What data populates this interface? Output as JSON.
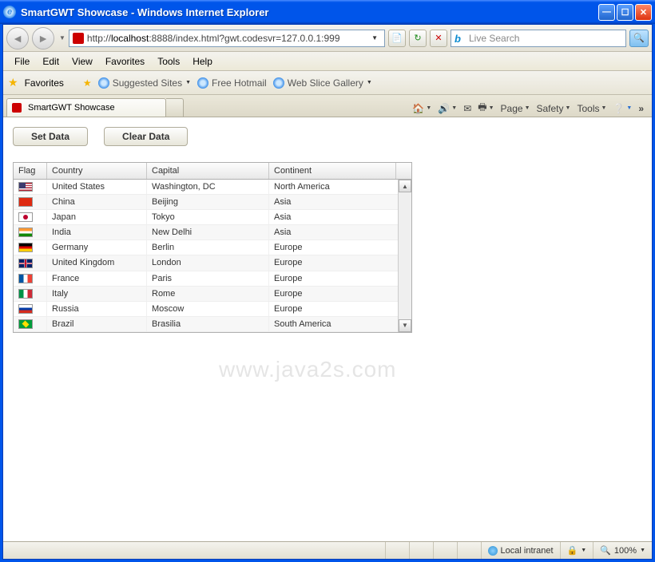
{
  "window": {
    "title": "SmartGWT Showcase - Windows Internet Explorer"
  },
  "nav": {
    "url_prefix": "http://",
    "url_host": "localhost",
    "url_rest": ":8888/index.html?gwt.codesvr=127.0.0.1:999",
    "refresh_glyph": "↻",
    "stop_glyph": "✕",
    "search_placeholder": "Live Search",
    "search_go_glyph": "🔍"
  },
  "menu": {
    "items": [
      "File",
      "Edit",
      "View",
      "Favorites",
      "Tools",
      "Help"
    ]
  },
  "favbar": {
    "label": "Favorites",
    "links": [
      "Suggested Sites",
      "Free Hotmail",
      "Web Slice Gallery"
    ]
  },
  "tabs": {
    "active": "SmartGWT Showcase",
    "tools": [
      "Page",
      "Safety",
      "Tools"
    ]
  },
  "buttons": {
    "set": "Set Data",
    "clear": "Clear Data"
  },
  "grid": {
    "headers": [
      "Flag",
      "Country",
      "Capital",
      "Continent"
    ],
    "rows": [
      {
        "flag": "flag-us",
        "country": "United States",
        "capital": "Washington, DC",
        "continent": "North America"
      },
      {
        "flag": "flag-cn",
        "country": "China",
        "capital": "Beijing",
        "continent": "Asia"
      },
      {
        "flag": "flag-jp",
        "country": "Japan",
        "capital": "Tokyo",
        "continent": "Asia"
      },
      {
        "flag": "flag-in",
        "country": "India",
        "capital": "New Delhi",
        "continent": "Asia"
      },
      {
        "flag": "flag-de",
        "country": "Germany",
        "capital": "Berlin",
        "continent": "Europe"
      },
      {
        "flag": "flag-uk",
        "country": "United Kingdom",
        "capital": "London",
        "continent": "Europe"
      },
      {
        "flag": "flag-fr",
        "country": "France",
        "capital": "Paris",
        "continent": "Europe"
      },
      {
        "flag": "flag-it",
        "country": "Italy",
        "capital": "Rome",
        "continent": "Europe"
      },
      {
        "flag": "flag-ru",
        "country": "Russia",
        "capital": "Moscow",
        "continent": "Europe"
      },
      {
        "flag": "flag-br",
        "country": "Brazil",
        "capital": "Brasilia",
        "continent": "South America"
      }
    ]
  },
  "status": {
    "zone": "Local intranet",
    "zoom": "100%"
  },
  "watermark": "www.java2s.com"
}
